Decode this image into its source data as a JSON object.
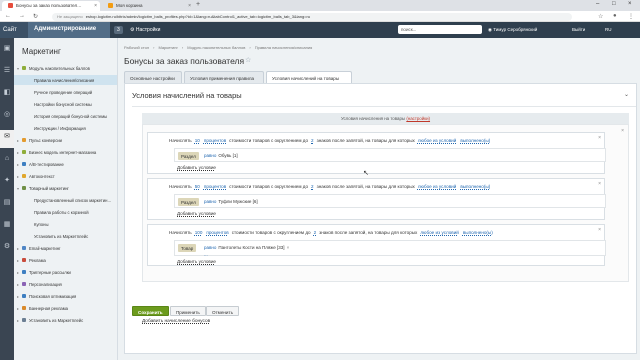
{
  "browser": {
    "tabs": [
      {
        "label": "Бонусы за заказ пользовател…",
        "active": true
      },
      {
        "label": "Моя корзина",
        "active": false
      }
    ],
    "url_secure_label": "Не защищено",
    "url": "eshop.logictim.ru/bitrix/admin/logictim_balls_profiles.php?id=1&lang=ru&tabControl1_active_tab=logictim_balls_tab_3&lang=ru"
  },
  "admin_bar": {
    "site_label": "Сайт",
    "admin_label": "Администрирование",
    "notifications_count": "3",
    "settings_label": "Настройки",
    "search_placeholder": "поиск...",
    "user_name": "Тимур Серобрянский",
    "exit_label": "Выйти",
    "lang_label": "RU"
  },
  "icon_bar": [
    {
      "icon": "desktop-icon",
      "label": "Рабочий стол",
      "glyph": "▣"
    },
    {
      "icon": "content-icon",
      "label": "Контент",
      "glyph": "☰"
    },
    {
      "icon": "landing-icon",
      "label": "Сайты",
      "glyph": "◧"
    },
    {
      "icon": "crm-icon",
      "label": "CRM",
      "glyph": "◎"
    },
    {
      "icon": "marketing-icon",
      "label": "Маркетинг",
      "glyph": "✉"
    },
    {
      "icon": "store-icon",
      "label": "Магазин",
      "glyph": "⌂"
    },
    {
      "icon": "services-icon",
      "label": "Сервисы",
      "glyph": "✦"
    },
    {
      "icon": "analytics-icon",
      "label": "Аналитика",
      "glyph": "▤"
    },
    {
      "icon": "marketplace-icon",
      "label": "Маркет",
      "glyph": "▦"
    },
    {
      "icon": "settings-icon",
      "label": "Настройки",
      "glyph": "⚙"
    }
  ],
  "sidebar": {
    "title": "Маркетинг",
    "items": [
      {
        "label": "Модуль накопительных баллов",
        "level": 0,
        "expanded": true,
        "icon_color": "#8fae3a"
      },
      {
        "label": "Правила начисления/списания",
        "level": 1,
        "selected": true
      },
      {
        "label": "Ручное проведение операций",
        "level": 1
      },
      {
        "label": "Настройки бонусной системы",
        "level": 1
      },
      {
        "label": "История операций бонусной системы",
        "level": 1
      },
      {
        "label": "Инструкции / Информация",
        "level": 1
      },
      {
        "label": "Пульс конверсии",
        "level": 0,
        "icon_color": "#e39b2f"
      },
      {
        "label": "Бизнес модель интернет-магазина",
        "level": 0,
        "icon_color": "#8fae3a"
      },
      {
        "label": "A/B-тестирование",
        "level": 0,
        "icon_color": "#3d7fc1"
      },
      {
        "label": "Автоконтекст",
        "level": 0,
        "icon_color": "#e0a72c"
      },
      {
        "label": "Товарный маркетинг",
        "level": 0,
        "expanded": true,
        "icon_color": "#6f8f45"
      },
      {
        "label": "Предустановленный список маркетин…",
        "level": 1
      },
      {
        "label": "Правила работы с корзиной",
        "level": 1
      },
      {
        "label": "Купоны",
        "level": 1
      },
      {
        "label": "Установить из Маркетплейс",
        "level": 1
      },
      {
        "label": "Email-маркетинг",
        "level": 0,
        "icon_color": "#4f86c5"
      },
      {
        "label": "Реклама",
        "level": 0,
        "icon_color": "#c94c3c"
      },
      {
        "label": "Триггерные рассылки",
        "level": 0,
        "icon_color": "#3d7fc1"
      },
      {
        "label": "Персонализация",
        "level": 0,
        "icon_color": "#8a63b5"
      },
      {
        "label": "Поисковая оптимизация",
        "level": 0,
        "icon_color": "#3d7fc1"
      },
      {
        "label": "Баннерная реклама",
        "level": 0,
        "icon_color": "#d98a2b"
      },
      {
        "label": "Установить из Маркетплейс",
        "level": 0,
        "icon_color": "#6b7f93"
      }
    ]
  },
  "breadcrumbs": [
    "Рабочий стол",
    "Маркетинг",
    "Модуль накопительных баллов",
    "Правила начисления/списания"
  ],
  "page_title": "Бонусы за заказ пользователя",
  "tabs": [
    {
      "label": "Основные настройки",
      "active": false
    },
    {
      "label": "Условия применения правила",
      "active": false
    },
    {
      "label": "Условия начислений на товары",
      "active": true
    }
  ],
  "panel": {
    "title": "Условия начислений на товары",
    "conditions_header_prefix": "Условия начисления на товары",
    "conditions_header_link": "(настройки)",
    "add_accrual_label": "Добавить начисление бонусов",
    "add_condition_label": "Добавить условие",
    "rules": [
      {
        "word_accrue": "Начислять",
        "amount": "10",
        "unit": "процентов",
        "mid_text": "стоимости товаров с округлением до",
        "decimals": "2",
        "tail_text": "знаков после запятой, на товары для которых",
        "logic": "любое из условий",
        "state": "выполнено(ы)",
        "tag": "Раздел",
        "eq": "равно",
        "value": "Обувь [1]",
        "extra": ""
      },
      {
        "word_accrue": "Начислять",
        "amount": "50",
        "unit": "процентов",
        "mid_text": "стоимости товаров с округлением до",
        "decimals": "2",
        "tail_text": "знаков после запятой, на товары для которых",
        "logic": "любое из условий",
        "state": "выполнено(ы)",
        "tag": "Раздел",
        "eq": "равно",
        "value": "Туфли Мужские [6]",
        "extra": ""
      },
      {
        "word_accrue": "Начислять",
        "amount": "100",
        "unit": "процентов",
        "mid_text": "стоимости товаров с округлением до",
        "decimals": "2",
        "tail_text": "знаков после запятой, на товары для которых",
        "logic": "любое из условий",
        "state": "выполнено(ы)",
        "tag": "Товар",
        "eq": "равно",
        "value": "Пантолеты Кости на Пляже [33]",
        "extra": "..."
      }
    ]
  },
  "footer": {
    "save_label": "Сохранить",
    "apply_label": "Применить",
    "cancel_label": "Отменить"
  }
}
